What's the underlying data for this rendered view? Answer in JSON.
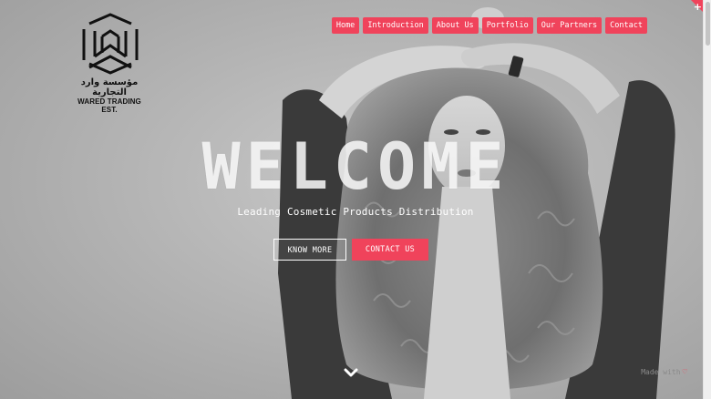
{
  "brand": {
    "arabic_name": "مؤسسة وارد التجارية",
    "english_name": "WARED TRADING EST."
  },
  "nav": {
    "items": [
      {
        "label": "Home"
      },
      {
        "label": "Introduction"
      },
      {
        "label": "About Us"
      },
      {
        "label": "Portfolio"
      },
      {
        "label": "Our Partners"
      },
      {
        "label": "Contact"
      }
    ]
  },
  "hero": {
    "title": "WELCOME",
    "subtitle": "Leading Cosmetic Products Distribution",
    "primary_button": "KNOW MORE",
    "secondary_button": "CONTACT US"
  },
  "footer": {
    "made_with": "Made with"
  },
  "corner": {
    "symbol": "+"
  },
  "colors": {
    "accent": "#f0435b",
    "background": "#b5b5b5",
    "text_light": "#ffffff"
  },
  "icons": {
    "scroll": "chevron-down-icon",
    "heart": "heart-icon",
    "logo": "hexagon-logo-icon"
  }
}
